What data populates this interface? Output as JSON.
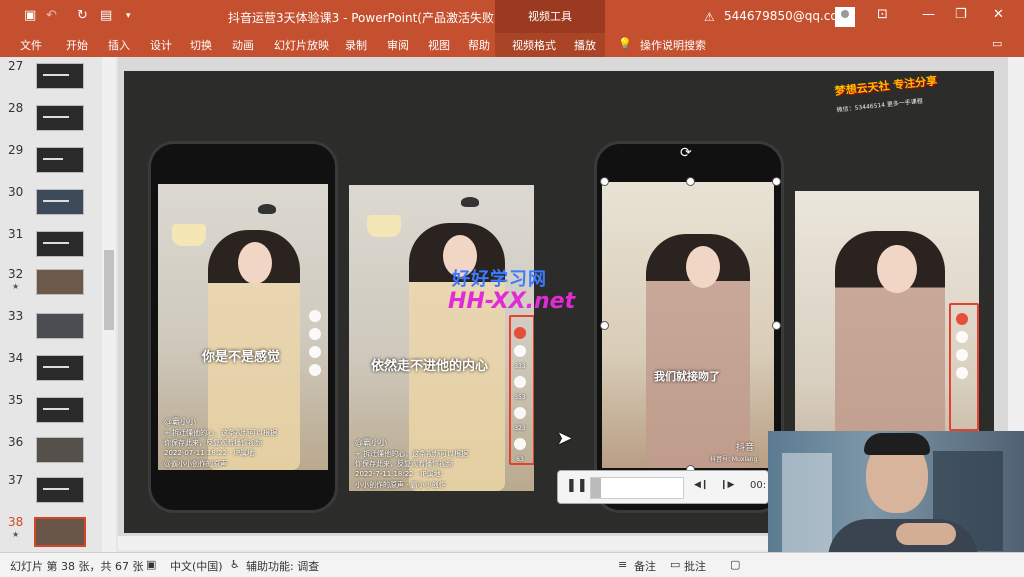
{
  "titlebar": {
    "title": "抖音运营3天体验课3 - PowerPoint(产品激活失败)",
    "context_title": "视频工具",
    "account": "544679850@qq.com",
    "warning_icon": "warning-icon",
    "colors": {
      "accent": "#c5502f",
      "context": "#9b3a20"
    }
  },
  "ribbon": {
    "tabs": [
      "文件",
      "开始",
      "插入",
      "设计",
      "切换",
      "动画",
      "幻灯片放映",
      "录制",
      "审阅",
      "视图",
      "帮助",
      "视频格式",
      "播放"
    ],
    "search_label": "操作说明搜索"
  },
  "slides": {
    "numbers": [
      "27",
      "28",
      "29",
      "30",
      "31",
      "32",
      "33",
      "34",
      "35",
      "36",
      "37",
      "38"
    ],
    "selected": "38"
  },
  "slide": {
    "watermark_line1": "好好学习网",
    "watermark_line2": "HH-XX.net",
    "logo_text": "梦想云天社 专注分享",
    "logo_small": "微信：53446514 更多一手课程",
    "phones": [
      {
        "subtitle": "你是不是感觉",
        "user": "@霸小小",
        "desc": "+ 拆迁懂他的心，这条视频可以根据你保存此来，反复观看播惯视频",
        "date": "2022-07-11 18:22 · IP属地:",
        "music": "@霸小小创作的原声"
      },
      {
        "subtitle": "依然走不进他的内心",
        "user": "@霸小小",
        "desc": "+ 拆迁懂他的心，这条视频可以根据你保存此来，反复观看播惯视频",
        "date": "2022-7-11 18:22 · IP属地:",
        "music": "小小创作的原声 · 霸小小创作"
      },
      {
        "subtitle": "我们就接吻了",
        "brand": "抖音",
        "handle": "抖音号: Muxiang"
      },
      {
        "subtitle": ""
      }
    ],
    "counts": [
      "333",
      "353",
      "323",
      "393",
      "63"
    ]
  },
  "media": {
    "time": "00:"
  },
  "status": {
    "slide_info": "幻灯片 第 38 张，共 67 张",
    "language": "中文(中国)",
    "accessibility": "辅助功能: 调查",
    "notes": "备注",
    "comments": "批注"
  }
}
